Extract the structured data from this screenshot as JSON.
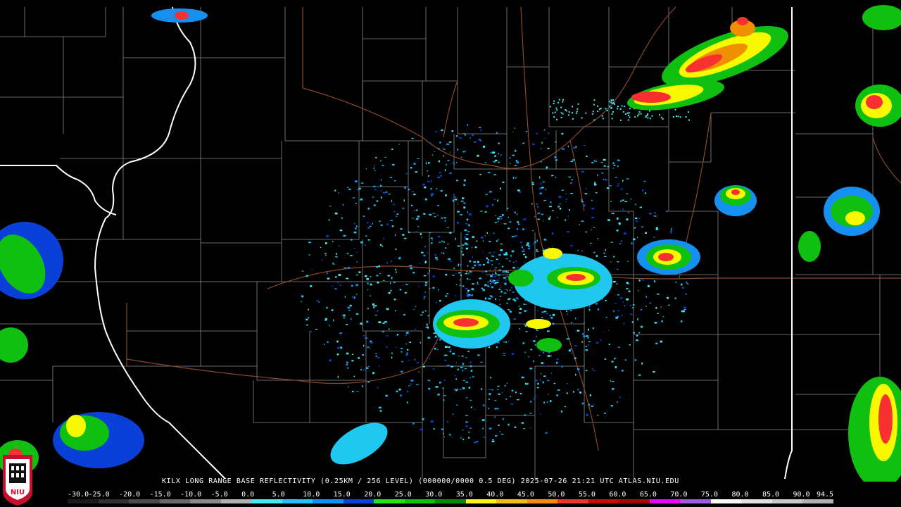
{
  "caption": "KILX LONG RANGE BASE REFLECTIVITY (0.25KM / 256 LEVEL) (000000/0000 0.5 DEG) 2025-07-26 21:21 UTC  ATLAS.NIU.EDU",
  "logo": {
    "text": "NIU",
    "color": "#c8102e"
  },
  "colorscale": {
    "labels": [
      "-30.0",
      "-25.0",
      "-20.0",
      "-15.0",
      "-10.0",
      "-5.0",
      "0.0",
      "5.0",
      "10.0",
      "15.0",
      "20.0",
      "25.0",
      "30.0",
      "35.0",
      "40.0",
      "45.0",
      "50.0",
      "55.0",
      "60.0",
      "65.0",
      "70.0",
      "75.0",
      "80.0",
      "85.0",
      "90.0",
      "94.5"
    ],
    "colors": [
      "#1a1a1a",
      "#303030",
      "#4a4a4a",
      "#686868",
      "#8a8a8a",
      "#b0b0b0",
      "#48e8f0",
      "#20c8f0",
      "#1690f0",
      "#0a40d8",
      "#18e818",
      "#10c010",
      "#088808",
      "#f8f800",
      "#f0c000",
      "#f09000",
      "#f83030",
      "#d80000",
      "#b00000",
      "#f800f8",
      "#9860d0",
      "#f8f8f8",
      "#e0e0e0",
      "#c8c8c8",
      "#b0b0b0"
    ]
  },
  "colors": {
    "county_line": "#8a8a8a",
    "state_line": "#ffffff",
    "highway": "#8b4a26"
  }
}
